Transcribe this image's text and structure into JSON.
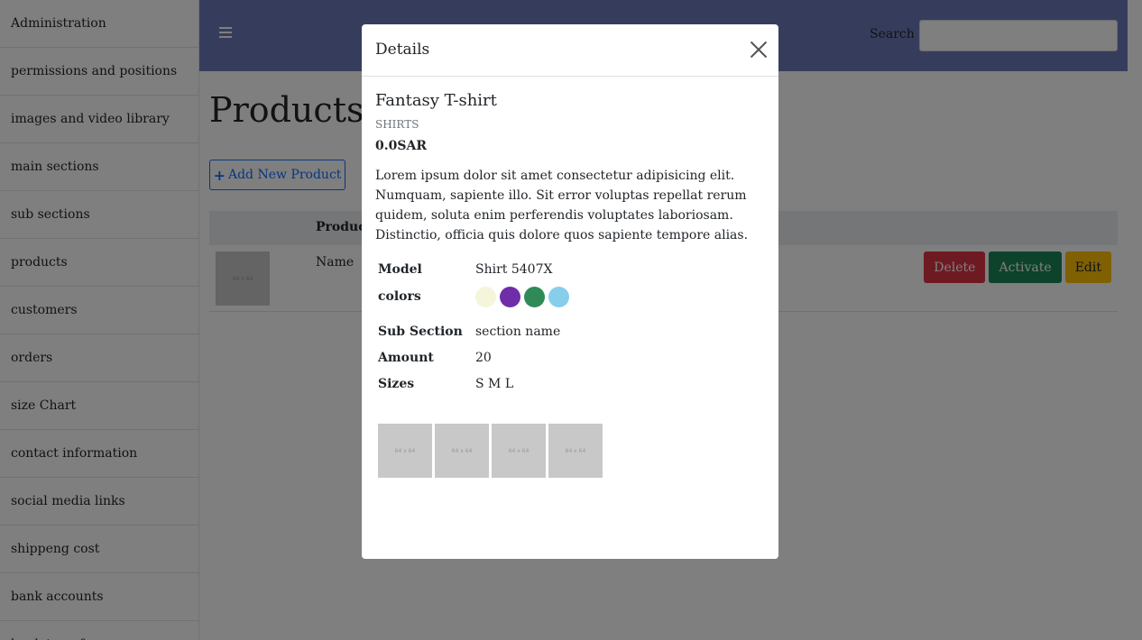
{
  "sidebar": {
    "items": [
      {
        "label": "Administration"
      },
      {
        "label": "permissions and positions"
      },
      {
        "label": "images and video library"
      },
      {
        "label": "main sections"
      },
      {
        "label": "sub sections"
      },
      {
        "label": "products"
      },
      {
        "label": "customers"
      },
      {
        "label": "orders"
      },
      {
        "label": "size Chart"
      },
      {
        "label": "contact information"
      },
      {
        "label": "social media links"
      },
      {
        "label": "shippeng cost"
      },
      {
        "label": "bank accounts"
      },
      {
        "label": "bank transfer"
      }
    ]
  },
  "header": {
    "menu_icon": "hamburger-icon",
    "search_label": "Search",
    "search_value": "",
    "search_placeholder": ""
  },
  "main": {
    "title": "Products",
    "add_button_icon": "+",
    "add_button_label": "Add New Product",
    "table": {
      "column_product": "Product",
      "row": {
        "thumb_text": "64 x 64",
        "name": "Name",
        "delete_label": "Delete",
        "activate_label": "Activate",
        "edit_label": "Edit"
      }
    }
  },
  "modal": {
    "title": "Details",
    "close_icon": "close-icon",
    "product": {
      "name": "Fantasy T-shirt",
      "category": "SHIRTS",
      "price": "0.0SAR",
      "description": "Lorem ipsum dolor sit amet consectetur adipisicing elit. Numquam, sapiente illo. Sit error voluptas repellat rerum quidem, soluta enim perferendis voluptates laboriosam. Distinctio, officia quis dolore quos sapiente tempore alias.",
      "specs": {
        "model_label": "Model",
        "model_value": "Shirt 5407X",
        "colors_label": "colors",
        "sub_section_label": "Sub Section",
        "sub_section_value": "section name",
        "amount_label": "Amount",
        "amount_value": "20",
        "sizes_label": "Sizes",
        "sizes_value": "S M L"
      },
      "colors": [
        "#f5f5dc",
        "#6f2da8",
        "#2e8b57",
        "#87ceeb"
      ],
      "gallery": [
        "64 x 64",
        "64 x 64",
        "64 x 64",
        "64 x 64"
      ]
    }
  },
  "theme": {
    "header_bg": "#6c7ab8",
    "primary": "#0d6efd",
    "danger": "#dc3545",
    "success": "#198754",
    "warning": "#ffc107"
  }
}
